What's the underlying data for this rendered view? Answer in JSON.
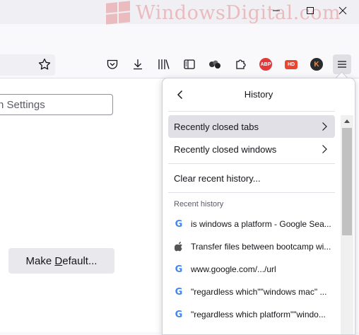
{
  "window": {
    "watermark": "WindowsDigital.com",
    "minimize": "minimize",
    "maximize": "maximize",
    "close": "close"
  },
  "toolbar": {
    "icons": [
      "star-icon",
      "pocket-icon",
      "download-icon",
      "library-icon",
      "sidebar-icon",
      "extension-dots-icon",
      "puzzle-icon",
      "abp-icon",
      "hd-icon",
      "k-extension-icon",
      "menu-icon"
    ],
    "abp_label": "ABP",
    "hd_label": "HD",
    "k_label": "K"
  },
  "page": {
    "search_placeholder": "n Settings",
    "make_default_prefix": "Make ",
    "make_default_underlined": "D",
    "make_default_suffix": "efault..."
  },
  "history_panel": {
    "title": "History",
    "recently_closed_tabs": "Recently closed tabs",
    "recently_closed_windows": "Recently closed windows",
    "clear_recent_history": "Clear recent history...",
    "recent_history_label": "Recent history",
    "items": [
      {
        "icon": "google-icon",
        "text": "is windows a platform - Google Sea..."
      },
      {
        "icon": "apple-icon",
        "text": "Transfer files between bootcamp wi..."
      },
      {
        "icon": "google-icon",
        "text": "www.google.com/.../url"
      },
      {
        "icon": "google-icon",
        "text": "\"regardless which\"\"windows mac\" ..."
      },
      {
        "icon": "google-icon",
        "text": "\"regardless which platform\"\"windo..."
      }
    ]
  }
}
